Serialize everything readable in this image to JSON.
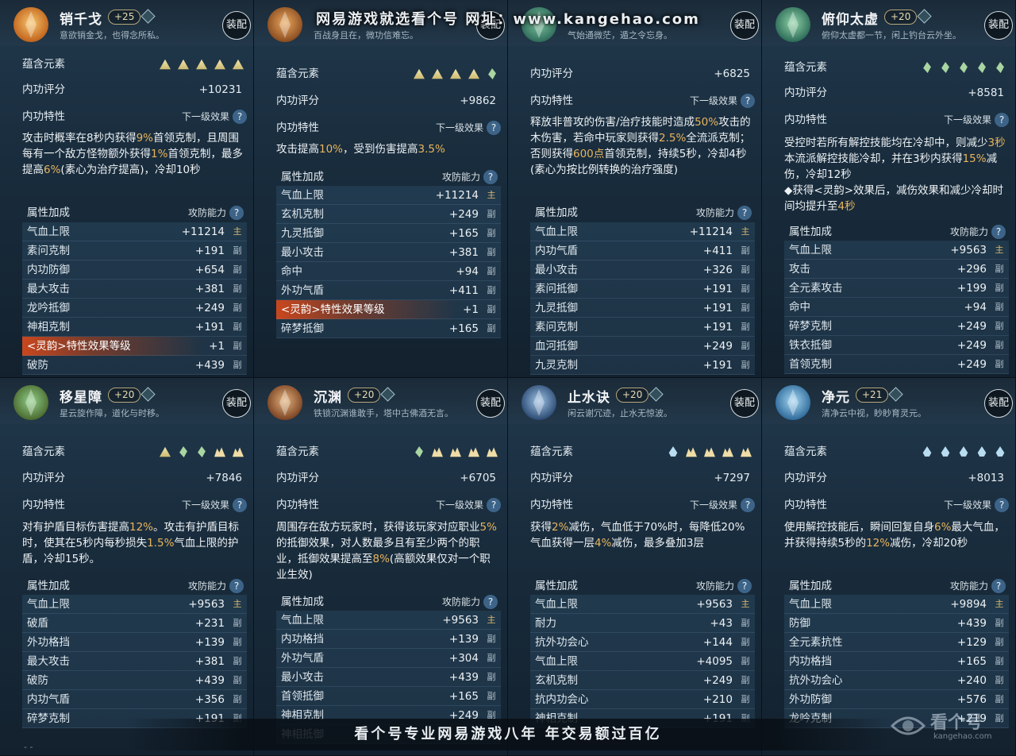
{
  "banner_top": "网易游戏就选看个号   网址：www.kangehao.com",
  "banner_bottom": "看个号专业网易游戏八年    年交易额过百亿",
  "watermark": {
    "text": "看个号",
    "url": "kangehao.com"
  },
  "corner_mark": "-  -",
  "labels": {
    "element": "蕴含元素",
    "score": "内功评分",
    "trait": "内功特性",
    "next_effect": "下一级效果",
    "attr_bonus": "属性加成",
    "atk_def": "攻防能力",
    "equip": "装配",
    "help": "?"
  },
  "tags": {
    "main": "主",
    "sub": "副"
  },
  "colors": {
    "highlight": "#e8b55d",
    "panel_bg": "#1a2e3f",
    "glow": "#c9471e"
  },
  "panels": [
    {
      "name": "销千戈",
      "level": "+25",
      "desc": "意欲销金戈，也得念所私。",
      "elements": [
        "tri",
        "tri",
        "tri",
        "tri",
        "tri"
      ],
      "score": "+10231",
      "trait": [
        {
          "t": "攻击时概率在8秒内获得"
        },
        {
          "t": "9%",
          "h": true
        },
        {
          "t": "首领克制，且周围每有一个敌方怪物额外获得"
        },
        {
          "t": "1%",
          "h": true
        },
        {
          "t": "首领克制，最多提高"
        },
        {
          "t": "6%",
          "h": true
        },
        {
          "t": "(素心为治疗提高)，冷却10秒"
        }
      ],
      "attrs": [
        {
          "name": "气血上限",
          "value": "+11214",
          "tag": "main"
        },
        {
          "name": "素问克制",
          "value": "+191",
          "tag": "sub"
        },
        {
          "name": "内功防御",
          "value": "+654",
          "tag": "sub"
        },
        {
          "name": "最大攻击",
          "value": "+381",
          "tag": "sub"
        },
        {
          "name": "龙吟抵御",
          "value": "+249",
          "tag": "sub"
        },
        {
          "name": "神相克制",
          "value": "+191",
          "tag": "sub"
        },
        {
          "name": "<灵韵>特性效果等级",
          "value": "+1",
          "tag": "sub",
          "glow": true
        },
        {
          "name": "破防",
          "value": "+439",
          "tag": "sub"
        }
      ]
    },
    {
      "name": "",
      "level": "",
      "desc": "百战身且在，微功信难忘。",
      "elements": [
        "tri",
        "tri",
        "tri",
        "tri",
        "leaf"
      ],
      "score": "+9862",
      "trait": [
        {
          "t": "攻击提高"
        },
        {
          "t": "10%",
          "h": true
        },
        {
          "t": "，受到伤害提高"
        },
        {
          "t": "3.5%",
          "h": true
        }
      ],
      "attrs": [
        {
          "name": "气血上限",
          "value": "+11214",
          "tag": "main"
        },
        {
          "name": "玄机克制",
          "value": "+249",
          "tag": "sub"
        },
        {
          "name": "九灵抵御",
          "value": "+165",
          "tag": "sub"
        },
        {
          "name": "最小攻击",
          "value": "+381",
          "tag": "sub"
        },
        {
          "name": "命中",
          "value": "+94",
          "tag": "sub"
        },
        {
          "name": "外功气盾",
          "value": "+411",
          "tag": "sub"
        },
        {
          "name": "<灵韵>特性效果等级",
          "value": "+1",
          "tag": "sub",
          "glow": true
        },
        {
          "name": "碎梦抵御",
          "value": "+165",
          "tag": "sub"
        }
      ]
    },
    {
      "name": "",
      "level": "",
      "desc": "气始通微茫，遁之令忘身。",
      "elements": [],
      "score": "+6825",
      "trait": [
        {
          "t": "释放非普攻的伤害/治疗技能时造成"
        },
        {
          "t": "50%",
          "h": true
        },
        {
          "t": "攻击的木伤害，若命中玩家则获得"
        },
        {
          "t": "2.5%",
          "h": true
        },
        {
          "t": "全流派克制；否则获得"
        },
        {
          "t": "600点",
          "h": true
        },
        {
          "t": "首领克制，持续5秒，冷却4秒(素心为按比例转换的治疗强度)"
        }
      ],
      "attrs": [
        {
          "name": "气血上限",
          "value": "+11214",
          "tag": "main"
        },
        {
          "name": "内功气盾",
          "value": "+411",
          "tag": "sub"
        },
        {
          "name": "最小攻击",
          "value": "+326",
          "tag": "sub"
        },
        {
          "name": "素问抵御",
          "value": "+191",
          "tag": "sub"
        },
        {
          "name": "九灵抵御",
          "value": "+191",
          "tag": "sub"
        },
        {
          "name": "素问克制",
          "value": "+191",
          "tag": "sub"
        },
        {
          "name": "血河抵御",
          "value": "+249",
          "tag": "sub"
        },
        {
          "name": "九灵克制",
          "value": "+191",
          "tag": "sub"
        }
      ]
    },
    {
      "name": "俯仰太虚",
      "level": "+20",
      "desc": "俯仰太虚都一节，闲上钓台云外坐。",
      "elements": [
        "leaf",
        "leaf",
        "leaf",
        "leaf",
        "leaf"
      ],
      "score": "+8581",
      "trait": [
        {
          "t": "受控时若所有解控技能均在冷却中，则减少"
        },
        {
          "t": "3秒",
          "h": true
        },
        {
          "t": "本流派解控技能冷却，并在3秒内获得"
        },
        {
          "t": "15%",
          "h": true
        },
        {
          "t": "减伤，冷却12秒\n◆获得<灵韵>效果后，减伤效果和减少冷却时间均提升至"
        },
        {
          "t": "4秒",
          "h": true
        }
      ],
      "attrs": [
        {
          "name": "气血上限",
          "value": "+9563",
          "tag": "main"
        },
        {
          "name": "攻击",
          "value": "+296",
          "tag": "sub"
        },
        {
          "name": "全元素攻击",
          "value": "+199",
          "tag": "sub"
        },
        {
          "name": "命中",
          "value": "+94",
          "tag": "sub"
        },
        {
          "name": "碎梦克制",
          "value": "+249",
          "tag": "sub"
        },
        {
          "name": "铁衣抵御",
          "value": "+249",
          "tag": "sub"
        },
        {
          "name": "首领克制",
          "value": "+249",
          "tag": "sub"
        }
      ]
    },
    {
      "name": "移星障",
      "level": "+20",
      "desc": "星云旋作障，道化与时移。",
      "elements": [
        "tri",
        "leaf",
        "leaf",
        "mtn",
        "mtn"
      ],
      "score": "+7846",
      "trait": [
        {
          "t": "对有护盾目标伤害提高"
        },
        {
          "t": "12%",
          "h": true
        },
        {
          "t": "。攻击有护盾目标时，使其在5秒内每秒损失"
        },
        {
          "t": "1.5%",
          "h": true
        },
        {
          "t": "气血上限的护盾，冷却15秒。"
        }
      ],
      "attrs": [
        {
          "name": "气血上限",
          "value": "+9563",
          "tag": "main"
        },
        {
          "name": "破盾",
          "value": "+231",
          "tag": "sub"
        },
        {
          "name": "外功格挡",
          "value": "+139",
          "tag": "sub"
        },
        {
          "name": "最大攻击",
          "value": "+381",
          "tag": "sub"
        },
        {
          "name": "破防",
          "value": "+439",
          "tag": "sub"
        },
        {
          "name": "内功气盾",
          "value": "+356",
          "tag": "sub"
        },
        {
          "name": "碎梦克制",
          "value": "+191",
          "tag": "sub"
        }
      ]
    },
    {
      "name": "沉渊",
      "level": "+20",
      "desc": "铁锁沉渊谁敢手，塔中古佛酒无言。",
      "elements": [
        "leaf",
        "mtn",
        "mtn",
        "mtn",
        "mtn"
      ],
      "score": "+6705",
      "trait": [
        {
          "t": "周围存在敌方玩家时，获得该玩家对应职业"
        },
        {
          "t": "5%",
          "h": true
        },
        {
          "t": "的抵御效果，对人数最多且有至少两个的职业，抵御效果提高至"
        },
        {
          "t": "8%",
          "h": true
        },
        {
          "t": "(高额效果仅对一个职业生效)"
        }
      ],
      "attrs": [
        {
          "name": "气血上限",
          "value": "+9563",
          "tag": "main"
        },
        {
          "name": "内功格挡",
          "value": "+139",
          "tag": "sub"
        },
        {
          "name": "外功气盾",
          "value": "+304",
          "tag": "sub"
        },
        {
          "name": "最小攻击",
          "value": "+439",
          "tag": "sub"
        },
        {
          "name": "首领抵御",
          "value": "+165",
          "tag": "sub"
        },
        {
          "name": "神相克制",
          "value": "+249",
          "tag": "sub"
        },
        {
          "name": "神相抵御",
          "value": "",
          "tag": "sub"
        }
      ]
    },
    {
      "name": "止水诀",
      "level": "+20",
      "desc": "闲云谢冗迹，止水无惊波。",
      "elements": [
        "drop",
        "mtn",
        "mtn",
        "mtn",
        "mtn"
      ],
      "score": "+7297",
      "trait": [
        {
          "t": "获得"
        },
        {
          "t": "2%",
          "h": true
        },
        {
          "t": "减伤，气血低于70%时，每降低20%气血获得一层"
        },
        {
          "t": "4%",
          "h": true
        },
        {
          "t": "减伤，最多叠加3层"
        }
      ],
      "attrs": [
        {
          "name": "气血上限",
          "value": "+9563",
          "tag": "main"
        },
        {
          "name": "耐力",
          "value": "+43",
          "tag": "sub"
        },
        {
          "name": "抗外功会心",
          "value": "+144",
          "tag": "sub"
        },
        {
          "name": "气血上限",
          "value": "+4095",
          "tag": "sub"
        },
        {
          "name": "玄机克制",
          "value": "+249",
          "tag": "sub"
        },
        {
          "name": "抗内功会心",
          "value": "+210",
          "tag": "sub"
        },
        {
          "name": "神相克制",
          "value": "+191",
          "tag": "sub"
        }
      ]
    },
    {
      "name": "净元",
      "level": "+21",
      "desc": "清净云中视，眇眇育灵元。",
      "elements": [
        "drop",
        "drop",
        "drop",
        "drop",
        "drop"
      ],
      "score": "+8013",
      "trait": [
        {
          "t": "使用解控技能后，瞬间回复自身"
        },
        {
          "t": "6%",
          "h": true
        },
        {
          "t": "最大气血，并获得持续5秒的"
        },
        {
          "t": "12%",
          "h": true
        },
        {
          "t": "减伤，冷却20秒"
        }
      ],
      "attrs": [
        {
          "name": "气血上限",
          "value": "+9894",
          "tag": "main"
        },
        {
          "name": "防御",
          "value": "+439",
          "tag": "sub"
        },
        {
          "name": "全元素抗性",
          "value": "+129",
          "tag": "sub"
        },
        {
          "name": "内功格挡",
          "value": "+165",
          "tag": "sub"
        },
        {
          "name": "抗外功会心",
          "value": "+240",
          "tag": "sub"
        },
        {
          "name": "外功防御",
          "value": "+576",
          "tag": "sub"
        },
        {
          "name": "龙吟克制",
          "value": "+219",
          "tag": "sub"
        }
      ]
    }
  ]
}
